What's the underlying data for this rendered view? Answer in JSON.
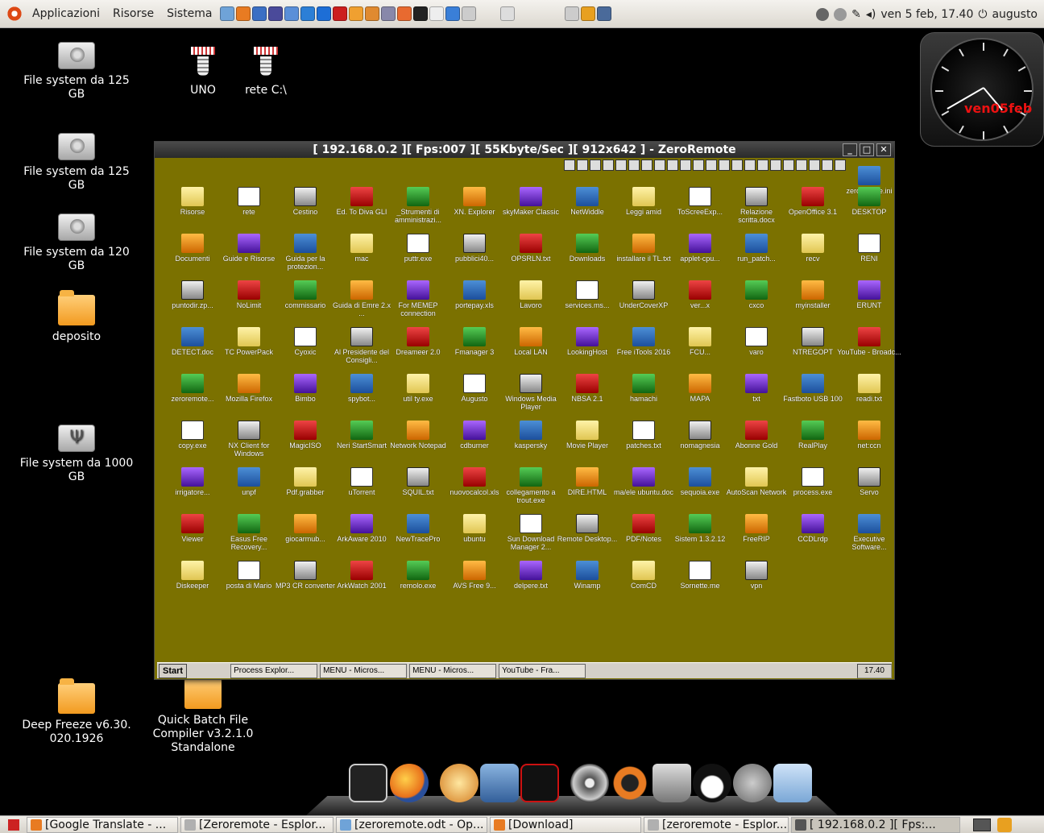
{
  "top_panel": {
    "menus": [
      "Applicazioni",
      "Risorse",
      "Sistema"
    ],
    "clock": "ven  5 feb, 17.40",
    "user": "augusto"
  },
  "desktop_icons": [
    {
      "label": "File system da 125 GB",
      "kind": "drive"
    },
    {
      "label": "File system da 125 GB",
      "kind": "drive"
    },
    {
      "label": "File system da 120 GB",
      "kind": "drive"
    },
    {
      "label": "deposito",
      "kind": "folder"
    },
    {
      "label": "File system da 1000 GB",
      "kind": "usb"
    },
    {
      "label": "Deep Freeze v6.30. 020.1926",
      "kind": "folder"
    },
    {
      "label": "Quick Batch File Compiler v3.2.1.0 Standalone",
      "kind": "folder"
    },
    {
      "label": "UNO",
      "kind": "network"
    },
    {
      "label": "rete C:\\",
      "kind": "network"
    }
  ],
  "clock_widget": {
    "date": "ven05feb"
  },
  "remote_window": {
    "title": "[ 192.168.0.2 ][ Fps:007 ][ 55Kbyte/Sec ][ 912x642 ] - ZeroRemote",
    "background": "#7b7100",
    "icons": [
      "zeroremote.ini",
      "Risorse",
      "rete",
      "Cestino",
      "Ed. To Diva GLI",
      "_Strumenti di amministrazi...",
      "XN. Explorer",
      "skyMaker Classic",
      "NetWiddle",
      "Leggi amid",
      "ToScreeExp...",
      "Relazione scritta.docx",
      "OpenOffice 3.1",
      "DESKTOP",
      "Documenti",
      "Guide e Risorse",
      "Guida per la protezion...",
      "mac",
      "puttr.exe",
      "pubblici40...",
      "OPSRLN.txt",
      "Downloads",
      "installare il TL.txt",
      "applet-cpu...",
      "run_patch...",
      "recv",
      "RENI",
      "puntodir.zp...",
      "NoLimit",
      "commissario",
      "Guida di Emre 2.x ...",
      "For MEMEP connection",
      "portepay.xls",
      "Lavoro",
      "services.ms...",
      "UnderCoverXP",
      "ver...x",
      "cxco",
      "myinstaller",
      "ERUNT",
      "DETECT.doc",
      "TC PowerPack",
      "Cyoxic",
      "Al Presidente del Consigli...",
      "Dreameer 2.0",
      "Fmanager 3",
      "Local LAN",
      "LookingHost",
      "Free iTools 2016",
      "FCU...",
      "varo",
      "NTREGOPT",
      "YouTube - Broadc...",
      "zeroremote...",
      "Mozilla Firefox",
      "Bimbo",
      "spybot...",
      "util ty.exe",
      "Augusto",
      "Windows Media Player",
      "NBSA 2.1",
      "hamachi",
      "MAPA",
      "txt",
      "Fastboto USB 100",
      "readi.txt",
      "copy.exe",
      "NX Client for Windows",
      "MagicISO",
      "Neri StartSmart",
      "Network Notepad",
      "cdburner",
      "kaspersky",
      "Movie Player",
      "patches.txt",
      "nomagnesia",
      "Abonne Gold",
      "RealPlay",
      "net:ccn",
      "irrigatore...",
      "unpf",
      "Pdf.grabber",
      "uTorrent",
      "SQUIL.txt",
      "nuovocalcol.xls",
      "collegamento a trout.exe",
      "DIRE.HTML",
      "ma/ele ubuntu.doc",
      "sequoia.exe",
      "AutoScan Network",
      "process.exe",
      "Servo",
      "Viewer",
      "Easus Free Recovery...",
      "giocarmub...",
      "ArkAware 2010",
      "NewTracePro",
      "ubuntu",
      "Sun Download Manager 2...",
      "Remote Desktop...",
      "PDF/Notes",
      "Sistem 1.3.2.12",
      "FreeRIP",
      "CCDLrdp",
      "Executive Software...",
      "Diskeeper",
      "posta di Mario",
      "MP3 CR converter",
      "ArkWatch 2001",
      "remolo.exe",
      "AVS Free 9...",
      "delpere.txt",
      "Winamp",
      "ComCD",
      "Sornette.me",
      "vpn"
    ],
    "taskbar": {
      "start": "Start",
      "tasks": [
        "Process Explor...",
        "MENU - Micros...",
        "MENU - Micros...",
        "YouTube - Fra..."
      ],
      "clock": "17.40"
    }
  },
  "bottom_panel": {
    "tasks": [
      {
        "label": "[Google Translate - ...",
        "color": "#e87b22"
      },
      {
        "label": "[Zeroremote - Esplor...",
        "color": "#b0b0b0"
      },
      {
        "label": "[zeroremote.odt - Op...",
        "color": "#6fa3d8"
      },
      {
        "label": "[Download]",
        "color": "#e87b22"
      },
      {
        "label": "[zeroremote - Esplor...",
        "color": "#b0b0b0"
      },
      {
        "label": "[ 192.168.0.2 ][ Fps:...",
        "color": "#555555"
      }
    ]
  },
  "dock_icons": [
    "terminal-icon",
    "firefox-icon",
    "nautilus-icon",
    "openoffice-icon",
    "acrobat-icon",
    "dvd-icon",
    "ubuntu-icon",
    "trash-icon",
    "tux-icon",
    "pot-icon",
    "folder-icon"
  ]
}
